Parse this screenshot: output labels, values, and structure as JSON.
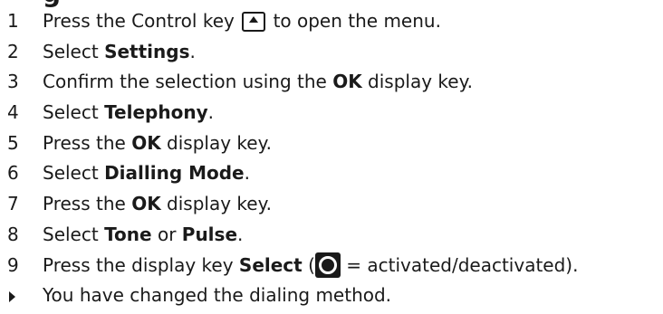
{
  "heading": "g",
  "steps": [
    {
      "num": "1",
      "pre": "Press the Control key",
      "post": "to open the menu."
    },
    {
      "num": "2",
      "pre": "Select ",
      "bold": "Settings",
      "post": "."
    },
    {
      "num": "3",
      "pre": "Confirm the selection using the ",
      "bold": "OK",
      "post": " display key."
    },
    {
      "num": "4",
      "pre": "Select ",
      "bold": "Telephony",
      "post": "."
    },
    {
      "num": "5",
      "pre": "Press the ",
      "bold": "OK",
      "post": " display key."
    },
    {
      "num": "6",
      "pre": "Select ",
      "bold": "Dialling Mode",
      "post": "."
    },
    {
      "num": "7",
      "pre": "Press the ",
      "bold": "OK",
      "post": " display key."
    },
    {
      "num": "8",
      "pre": "Select ",
      "bold": "Tone",
      "mid": " or ",
      "bold2": "Pulse",
      "post": "."
    },
    {
      "num": "9",
      "pre": "Press the display key ",
      "bold": "Select",
      "paren_open": " (",
      "post": " = activated/deactivated)."
    }
  ],
  "result": "You have changed the dialing method.",
  "icons": {
    "control_key": "control-key-icon",
    "radio": "radio-button-icon",
    "result_marker": "result-arrow-icon"
  }
}
